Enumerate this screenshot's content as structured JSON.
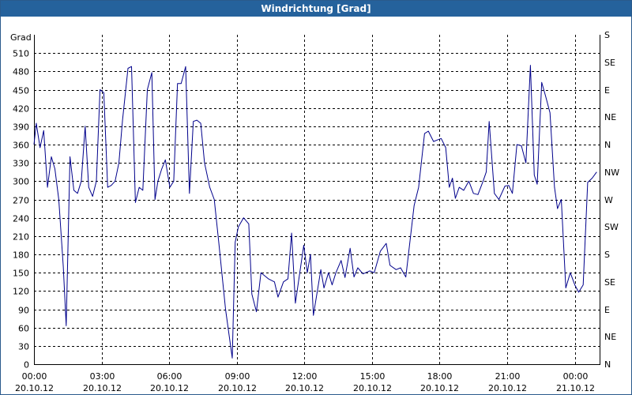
{
  "window": {
    "title": "Windrichtung [Grad]"
  },
  "chart_data": {
    "type": "line",
    "ylabel": "Grad",
    "ylim": [
      0,
      540
    ],
    "y_ticks": [
      0,
      30,
      60,
      90,
      120,
      150,
      180,
      210,
      240,
      270,
      300,
      330,
      360,
      390,
      420,
      450,
      480,
      510
    ],
    "y_right_ticks": [
      {
        "y": 0,
        "label": "N"
      },
      {
        "y": 45,
        "label": "NE"
      },
      {
        "y": 90,
        "label": "E"
      },
      {
        "y": 135,
        "label": "SE"
      },
      {
        "y": 180,
        "label": "S"
      },
      {
        "y": 225,
        "label": "SW"
      },
      {
        "y": 270,
        "label": "W"
      },
      {
        "y": 315,
        "label": "NW"
      },
      {
        "y": 360,
        "label": "N"
      },
      {
        "y": 405,
        "label": "NE"
      },
      {
        "y": 450,
        "label": "E"
      },
      {
        "y": 495,
        "label": "SE"
      },
      {
        "y": 540,
        "label": "S"
      }
    ],
    "xlim": [
      0,
      24
    ],
    "x_ticks": [
      {
        "x": 0,
        "time": "00:00",
        "date": "20.10.12"
      },
      {
        "x": 3,
        "time": "03:00",
        "date": "20.10.12"
      },
      {
        "x": 6,
        "time": "06:00",
        "date": "20.10.12"
      },
      {
        "x": 9,
        "time": "09:00",
        "date": "20.10.12"
      },
      {
        "x": 12,
        "time": "12:00",
        "date": "20.10.12"
      },
      {
        "x": 15,
        "time": "15:00",
        "date": "20.10.12"
      },
      {
        "x": 18,
        "time": "18:00",
        "date": "20.10.12"
      },
      {
        "x": 21,
        "time": "21:00",
        "date": "20.10.12"
      },
      {
        "x": 24,
        "time": "00:00",
        "date": "21.10.12"
      }
    ],
    "grid": true,
    "line_color": "#00008b",
    "series": [
      {
        "name": "",
        "points": [
          [
            0.0,
            360
          ],
          [
            0.1,
            395
          ],
          [
            0.27,
            355
          ],
          [
            0.43,
            383
          ],
          [
            0.6,
            290
          ],
          [
            0.77,
            340
          ],
          [
            0.93,
            320
          ],
          [
            1.1,
            270
          ],
          [
            1.3,
            160
          ],
          [
            1.43,
            63
          ],
          [
            1.6,
            340
          ],
          [
            1.77,
            285
          ],
          [
            1.93,
            280
          ],
          [
            2.1,
            300
          ],
          [
            2.27,
            390
          ],
          [
            2.43,
            290
          ],
          [
            2.6,
            275
          ],
          [
            2.77,
            300
          ],
          [
            2.93,
            450
          ],
          [
            3.1,
            445
          ],
          [
            3.27,
            290
          ],
          [
            3.43,
            293
          ],
          [
            3.6,
            300
          ],
          [
            3.77,
            330
          ],
          [
            3.93,
            400
          ],
          [
            4.17,
            485
          ],
          [
            4.33,
            488
          ],
          [
            4.5,
            265
          ],
          [
            4.67,
            290
          ],
          [
            4.83,
            285
          ],
          [
            5.03,
            450
          ],
          [
            5.23,
            478
          ],
          [
            5.37,
            270
          ],
          [
            5.5,
            300
          ],
          [
            5.67,
            320
          ],
          [
            5.83,
            335
          ],
          [
            6.03,
            290
          ],
          [
            6.2,
            300
          ],
          [
            6.37,
            460
          ],
          [
            6.53,
            460
          ],
          [
            6.73,
            488
          ],
          [
            6.9,
            280
          ],
          [
            7.07,
            398
          ],
          [
            7.23,
            400
          ],
          [
            7.4,
            395
          ],
          [
            7.57,
            330
          ],
          [
            7.8,
            290
          ],
          [
            8.0,
            270
          ],
          [
            8.2,
            200
          ],
          [
            8.5,
            90
          ],
          [
            8.8,
            10
          ],
          [
            8.93,
            200
          ],
          [
            9.07,
            225
          ],
          [
            9.3,
            240
          ],
          [
            9.53,
            230
          ],
          [
            9.67,
            115
          ],
          [
            9.87,
            86
          ],
          [
            10.07,
            150
          ],
          [
            10.4,
            140
          ],
          [
            10.67,
            135
          ],
          [
            10.83,
            110
          ],
          [
            11.07,
            135
          ],
          [
            11.27,
            140
          ],
          [
            11.43,
            215
          ],
          [
            11.6,
            100
          ],
          [
            11.97,
            195
          ],
          [
            12.13,
            150
          ],
          [
            12.27,
            180
          ],
          [
            12.4,
            80
          ],
          [
            12.73,
            155
          ],
          [
            12.87,
            125
          ],
          [
            13.07,
            150
          ],
          [
            13.23,
            130
          ],
          [
            13.4,
            150
          ],
          [
            13.63,
            170
          ],
          [
            13.8,
            142
          ],
          [
            14.03,
            190
          ],
          [
            14.2,
            143
          ],
          [
            14.37,
            158
          ],
          [
            14.6,
            148
          ],
          [
            14.9,
            153
          ],
          [
            15.1,
            150
          ],
          [
            15.37,
            185
          ],
          [
            15.63,
            198
          ],
          [
            15.8,
            162
          ],
          [
            16.07,
            155
          ],
          [
            16.27,
            158
          ],
          [
            16.5,
            143
          ],
          [
            16.87,
            260
          ],
          [
            17.07,
            290
          ],
          [
            17.33,
            378
          ],
          [
            17.5,
            382
          ],
          [
            17.73,
            365
          ],
          [
            17.93,
            368
          ],
          [
            18.07,
            370
          ],
          [
            18.27,
            355
          ],
          [
            18.43,
            290
          ],
          [
            18.57,
            305
          ],
          [
            18.7,
            272
          ],
          [
            18.87,
            290
          ],
          [
            19.07,
            285
          ],
          [
            19.3,
            300
          ],
          [
            19.5,
            280
          ],
          [
            19.7,
            278
          ],
          [
            19.93,
            300
          ],
          [
            20.07,
            315
          ],
          [
            20.2,
            398
          ],
          [
            20.43,
            280
          ],
          [
            20.63,
            270
          ],
          [
            20.9,
            292
          ],
          [
            21.07,
            293
          ],
          [
            21.23,
            280
          ],
          [
            21.43,
            360
          ],
          [
            21.63,
            358
          ],
          [
            21.83,
            330
          ],
          [
            22.03,
            490
          ],
          [
            22.2,
            310
          ],
          [
            22.33,
            295
          ],
          [
            22.53,
            462
          ],
          [
            22.7,
            440
          ],
          [
            22.9,
            412
          ],
          [
            23.1,
            290
          ],
          [
            23.23,
            255
          ],
          [
            23.4,
            270
          ],
          [
            23.6,
            125
          ],
          [
            23.8,
            150
          ],
          [
            24.0,
            130
          ],
          [
            24.17,
            118
          ],
          [
            24.37,
            130
          ],
          [
            24.57,
            298
          ],
          [
            24.77,
            305
          ],
          [
            24.97,
            315
          ]
        ]
      }
    ]
  }
}
